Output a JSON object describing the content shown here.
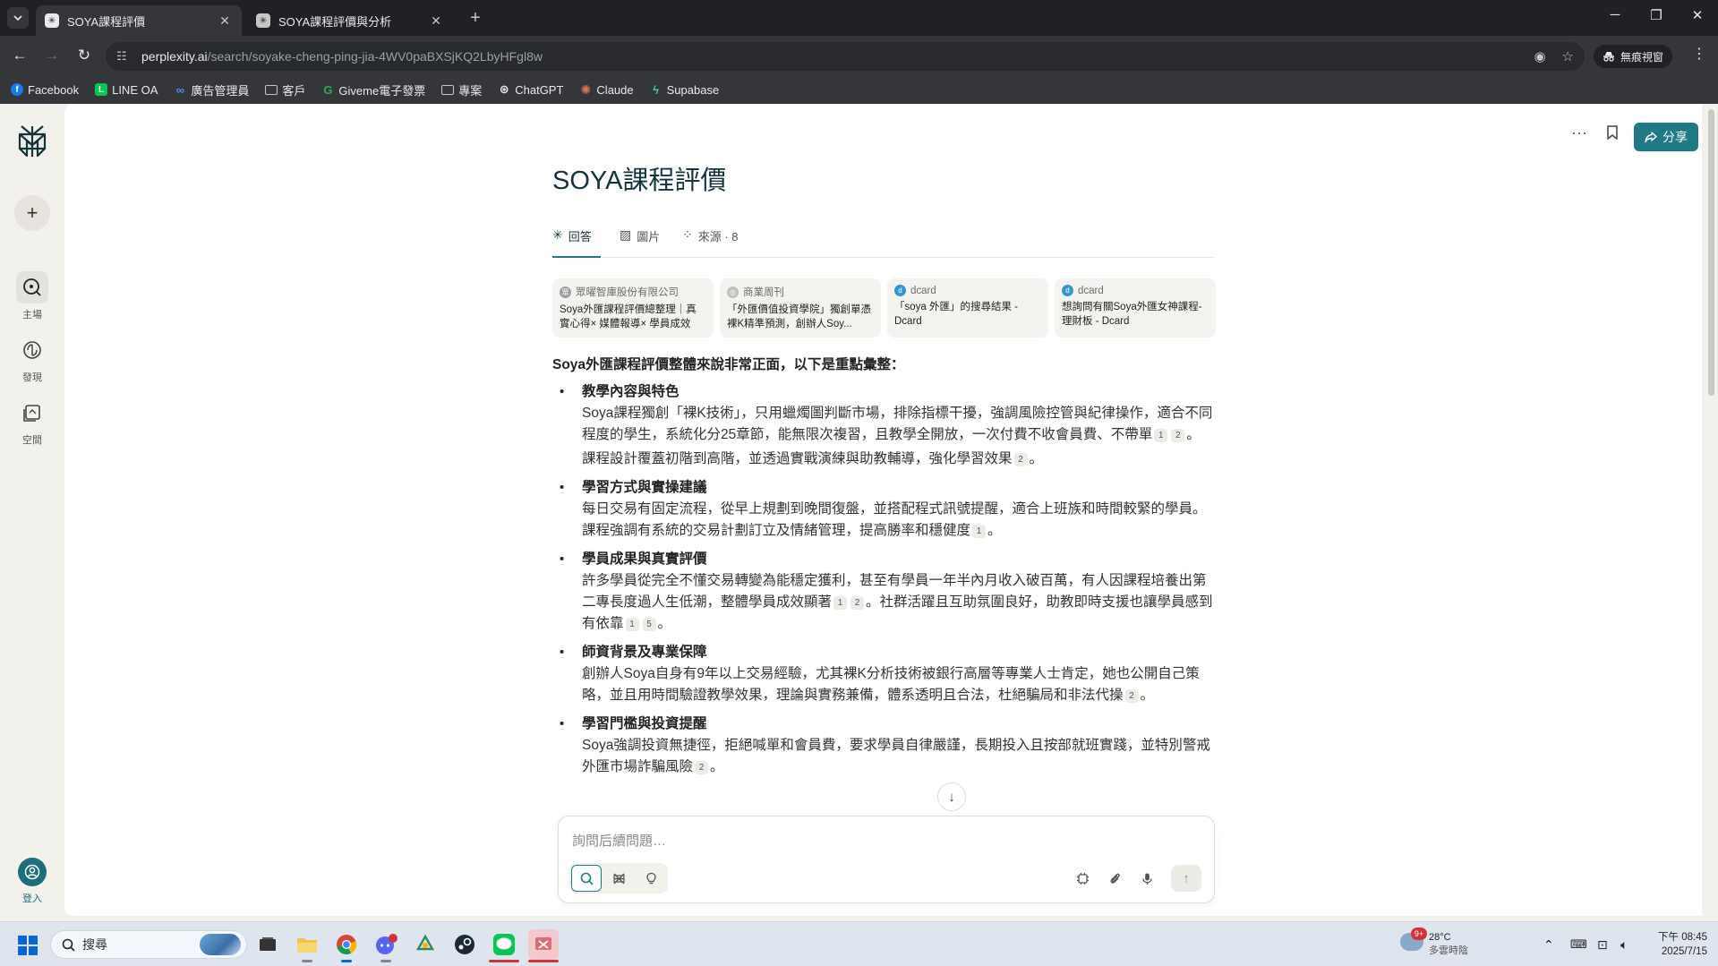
{
  "browser": {
    "tabs": [
      {
        "title": "SOYA課程評價",
        "active": true
      },
      {
        "title": "SOYA課程評價與分析",
        "active": false
      }
    ],
    "url_main": "perplexity.ai",
    "url_path": "/search/soyake-cheng-ping-jia-4WV0paBXSjKQ2LbyHFgl8w",
    "incognito_label": "無痕視窗",
    "bookmarks": [
      {
        "label": "Facebook",
        "icon": "facebook-icon",
        "color": "#1877f2"
      },
      {
        "label": "LINE OA",
        "icon": "line-icon",
        "color": "#06c755"
      },
      {
        "label": "廣告管理員",
        "icon": "meta-icon",
        "color": "#0668e1"
      },
      {
        "label": "客戶",
        "icon": "folder-icon",
        "color": "#e8eaed"
      },
      {
        "label": "Giveme電子發票",
        "icon": "giveme-icon",
        "color": "#34a853"
      },
      {
        "label": "專案",
        "icon": "folder-icon",
        "color": "#e8eaed"
      },
      {
        "label": "ChatGPT",
        "icon": "chatgpt-icon",
        "color": "#e8eaed"
      },
      {
        "label": "Claude",
        "icon": "claude-icon",
        "color": "#d97757"
      },
      {
        "label": "Supabase",
        "icon": "supabase-icon",
        "color": "#3ecf8e"
      }
    ]
  },
  "sidebar": {
    "items": [
      {
        "label": "主場",
        "icon": "home-search-icon",
        "active": true
      },
      {
        "label": "發現",
        "icon": "discover-icon",
        "active": false
      },
      {
        "label": "空間",
        "icon": "spaces-icon",
        "active": false
      }
    ],
    "login_label": "登入"
  },
  "header": {
    "share_label": "分享"
  },
  "query": {
    "title": "SOYA課程評價"
  },
  "result_tabs": [
    {
      "label": "回答",
      "icon": "perplexity-icon"
    },
    {
      "label": "圖片",
      "icon": "image-icon"
    },
    {
      "label": "來源 · 8",
      "icon": "sources-icon"
    }
  ],
  "sources": [
    {
      "site": "眾曜智庫股份有限公司",
      "title": "Soya外匯課程評價總整理｜真實心得× 媒體報導× 學員成效",
      "color": "#9aa0a6"
    },
    {
      "site": "商業周刊",
      "title": "「外匯價值投資學院」獨創單憑裸K精準預測，創辦人Soy...",
      "color": "#c0c0c0"
    },
    {
      "site": "dcard",
      "title": "「soya 外匯」的搜尋結果 - Dcard",
      "color": "#3397cf"
    },
    {
      "site": "dcard",
      "title": "想詢問有關Soya外匯女神課程- 理財板 - Dcard",
      "color": "#3397cf"
    }
  ],
  "answer": {
    "intro": "Soya外匯課程評價整體來說非常正面，以下是重點彙整：",
    "sections": [
      {
        "heading": "教學內容與特色",
        "paragraphs": [
          {
            "text": "Soya課程獨創「裸K技術」，只用蠟燭圖判斷市場，排除指標干擾，強調風險控管與紀律操作，適合不同程度的學生，系統化分25章節，能無限次複習，且教學全開放，一次付費不收會員費、不帶單",
            "cites": [
              "1",
              "2"
            ],
            "end": "。"
          },
          {
            "text": "課程設計覆蓋初階到高階，並透過實戰演練與助教輔導，強化學習效果",
            "cites": [
              "2"
            ],
            "end": "。"
          }
        ]
      },
      {
        "heading": "學習方式與實操建議",
        "paragraphs": [
          {
            "text": "每日交易有固定流程，從早上規劃到晚間復盤，並搭配程式訊號提醒，適合上班族和時間較緊的學員。課程強調有系統的交易計劃訂立及情緒管理，提高勝率和穩健度",
            "cites": [
              "1"
            ],
            "end": "。"
          }
        ]
      },
      {
        "heading": "學員成果與真實評價",
        "paragraphs": [
          {
            "text": "許多學員從完全不懂交易轉變為能穩定獲利，甚至有學員一年半內月收入破百萬，有人因課程培養出第二專長度過人生低潮，整體學員成效顯著",
            "cites": [
              "1",
              "2"
            ],
            "mid": "。社群活躍且互助氛圍良好，助教即時支援也讓學員感到有依靠",
            "cites2": [
              "1",
              "5"
            ],
            "end": "。"
          }
        ]
      },
      {
        "heading": "師資背景及專業保障",
        "paragraphs": [
          {
            "text": "創辦人Soya自身有9年以上交易經驗，尤其裸K分析技術被銀行高層等專業人士肯定，她也公開自己策略，並且用時間驗證教學效果，理論與實務兼備，體系透明且合法，杜絕騙局和非法代操",
            "cites": [
              "2"
            ],
            "end": "。"
          }
        ]
      },
      {
        "heading": "學習門檻與投資提醒",
        "paragraphs": [
          {
            "text": "Soya強調投資無捷徑，拒絕喊單和會員費，要求學員自律嚴謹，長期投入且按部就班實踐，並特別警戒外匯市場詐騙風險",
            "cites": [
              "2"
            ],
            "end": "。"
          }
        ]
      }
    ]
  },
  "ask": {
    "placeholder": "詢問后續問題…"
  },
  "taskbar": {
    "search_placeholder": "搜尋",
    "weather_temp": "28°C",
    "weather_desc": "多雲時陰",
    "weather_badge": "9+",
    "time": "下午 08:45",
    "date": "2025/7/15"
  },
  "colors": {
    "accent": "#1f7a85",
    "title": "#13343b",
    "page_bg": "#f2f1ec"
  }
}
